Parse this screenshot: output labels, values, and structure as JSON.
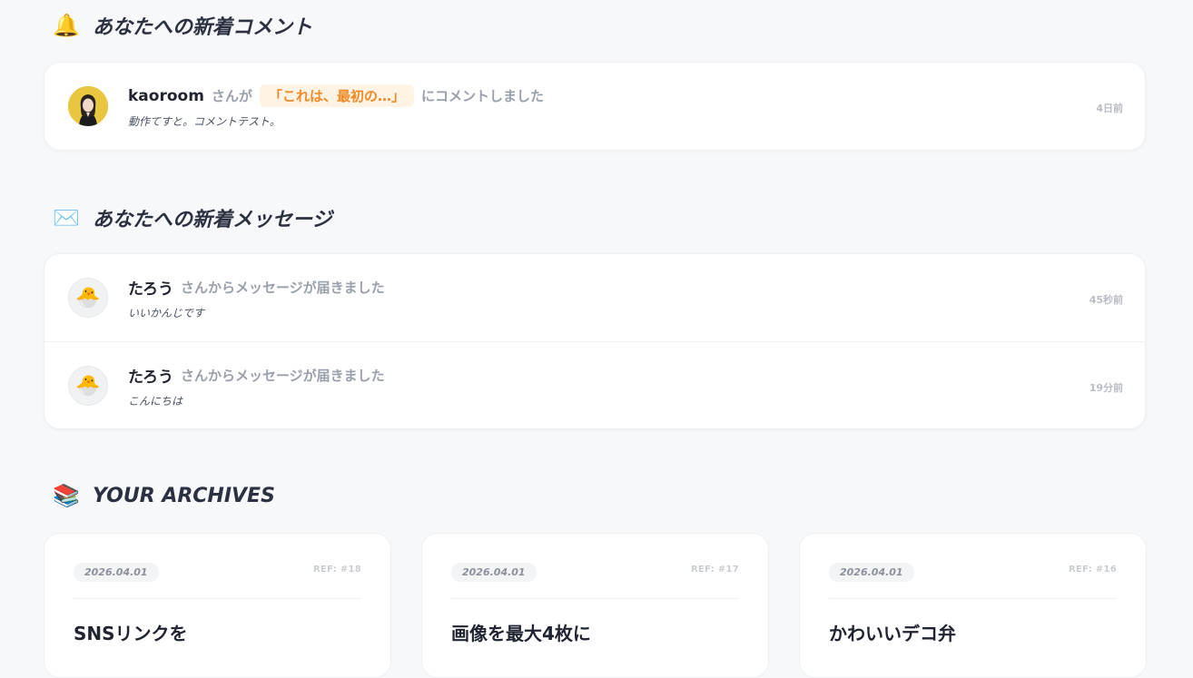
{
  "comments_section": {
    "icon": "bell-icon",
    "title": "あなたへの新着コメント",
    "items": [
      {
        "user": "kaoroom",
        "connector": "さんが",
        "post_title": "「これは、最初の…」",
        "action": "にコメントしました",
        "body": "動作てすと。コメントテスト。",
        "time": "4日前"
      }
    ]
  },
  "messages_section": {
    "icon": "envelope-icon",
    "title": "あなたへの新着メッセージ",
    "items": [
      {
        "user": "たろう",
        "action": "さんからメッセージが届きました",
        "body": "いいかんじです",
        "time": "45秒前"
      },
      {
        "user": "たろう",
        "action": "さんからメッセージが届きました",
        "body": "こんにちは",
        "time": "19分前"
      }
    ]
  },
  "archives_section": {
    "icon": "books-icon",
    "title": "YOUR ARCHIVES",
    "items": [
      {
        "date": "2026.04.01",
        "ref": "REF: #18",
        "title": "SNSリンクを"
      },
      {
        "date": "2026.04.01",
        "ref": "REF: #17",
        "title": "画像を最大4枚に"
      },
      {
        "date": "2026.04.01",
        "ref": "REF: #16",
        "title": "かわいいデコ弁"
      }
    ]
  }
}
